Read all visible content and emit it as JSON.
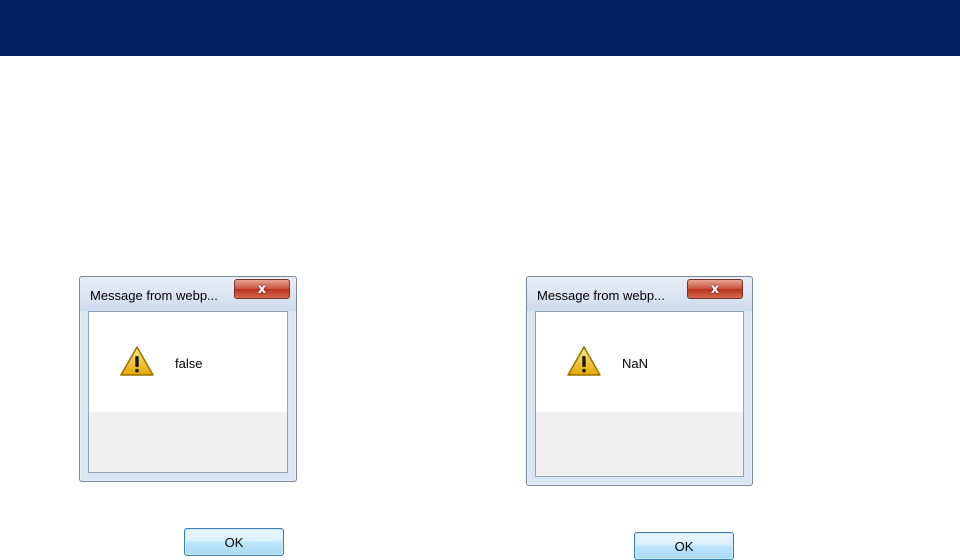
{
  "dialogs": [
    {
      "title": "Message from webp...",
      "close_glyph": "x",
      "message": "false",
      "icon": "warning-icon",
      "ok_label": "OK"
    },
    {
      "title": "Message from webp...",
      "close_glyph": "x",
      "message": "NaN",
      "icon": "warning-icon",
      "ok_label": "OK"
    }
  ],
  "colors": {
    "banner": "#002060",
    "dialog_frame": "#dbe6f3",
    "close_button": "#c9503a",
    "ok_button_border": "#3c7fb1",
    "warning_fill": "#f5c518"
  }
}
